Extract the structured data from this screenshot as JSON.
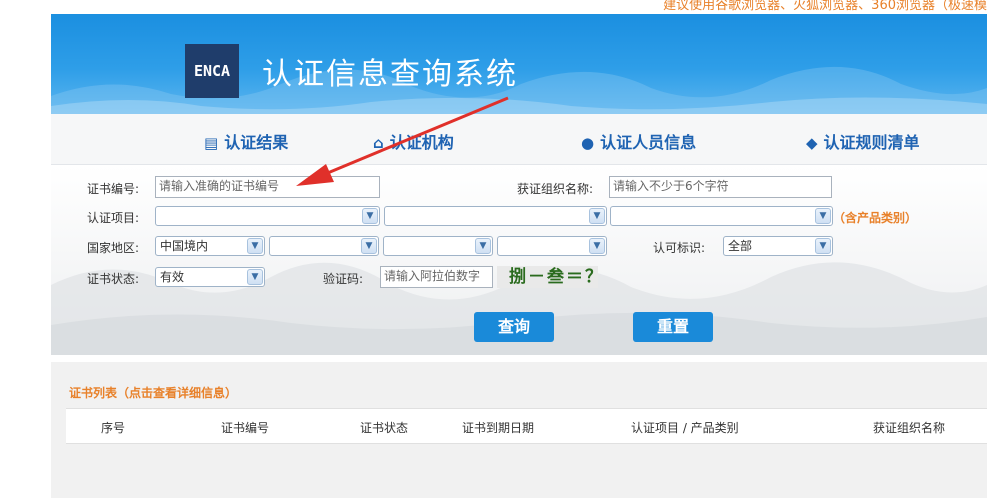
{
  "top_notice": "建议使用谷歌浏览器、火狐浏览器、360浏览器（极速模",
  "header": {
    "logo_text": "ENCA",
    "title": "认证信息查询系统"
  },
  "nav": {
    "items": [
      {
        "label": "认证结果",
        "icon": "list-icon"
      },
      {
        "label": "认证机构",
        "icon": "home-icon"
      },
      {
        "label": "认证人员信息",
        "icon": "user-icon"
      },
      {
        "label": "认证规则清单",
        "icon": "tags-icon"
      }
    ]
  },
  "form": {
    "cert_no_label": "证书编号:",
    "cert_no_placeholder": "请输入准确的证书编号",
    "org_name_label": "获证组织名称:",
    "org_name_placeholder": "请输入不少于6个字符",
    "project_label": "认证项目:",
    "project_hint": "（含产品类别）",
    "region_label": "国家地区:",
    "region_value": "中国境内",
    "mark_label": "认可标识:",
    "mark_value": "全部",
    "status_label": "证书状态:",
    "status_value": "有效",
    "captcha_label": "验证码:",
    "captcha_placeholder": "请输入阿拉伯数字",
    "captcha_text": "捌－叁＝？",
    "search_button": "查询",
    "reset_button": "重置"
  },
  "list": {
    "title": "证书列表（点击查看详细信息）",
    "columns": [
      "序号",
      "证书编号",
      "证书状态",
      "证书到期日期",
      "认证项目 / 产品类别",
      "获证组织名称"
    ]
  },
  "colors": {
    "banner_blue": "#1b8fe0",
    "nav_blue": "#1f63b2",
    "button_blue": "#1a8ad9",
    "accent_orange": "#e8812a",
    "annotation_red": "#e0302a"
  }
}
